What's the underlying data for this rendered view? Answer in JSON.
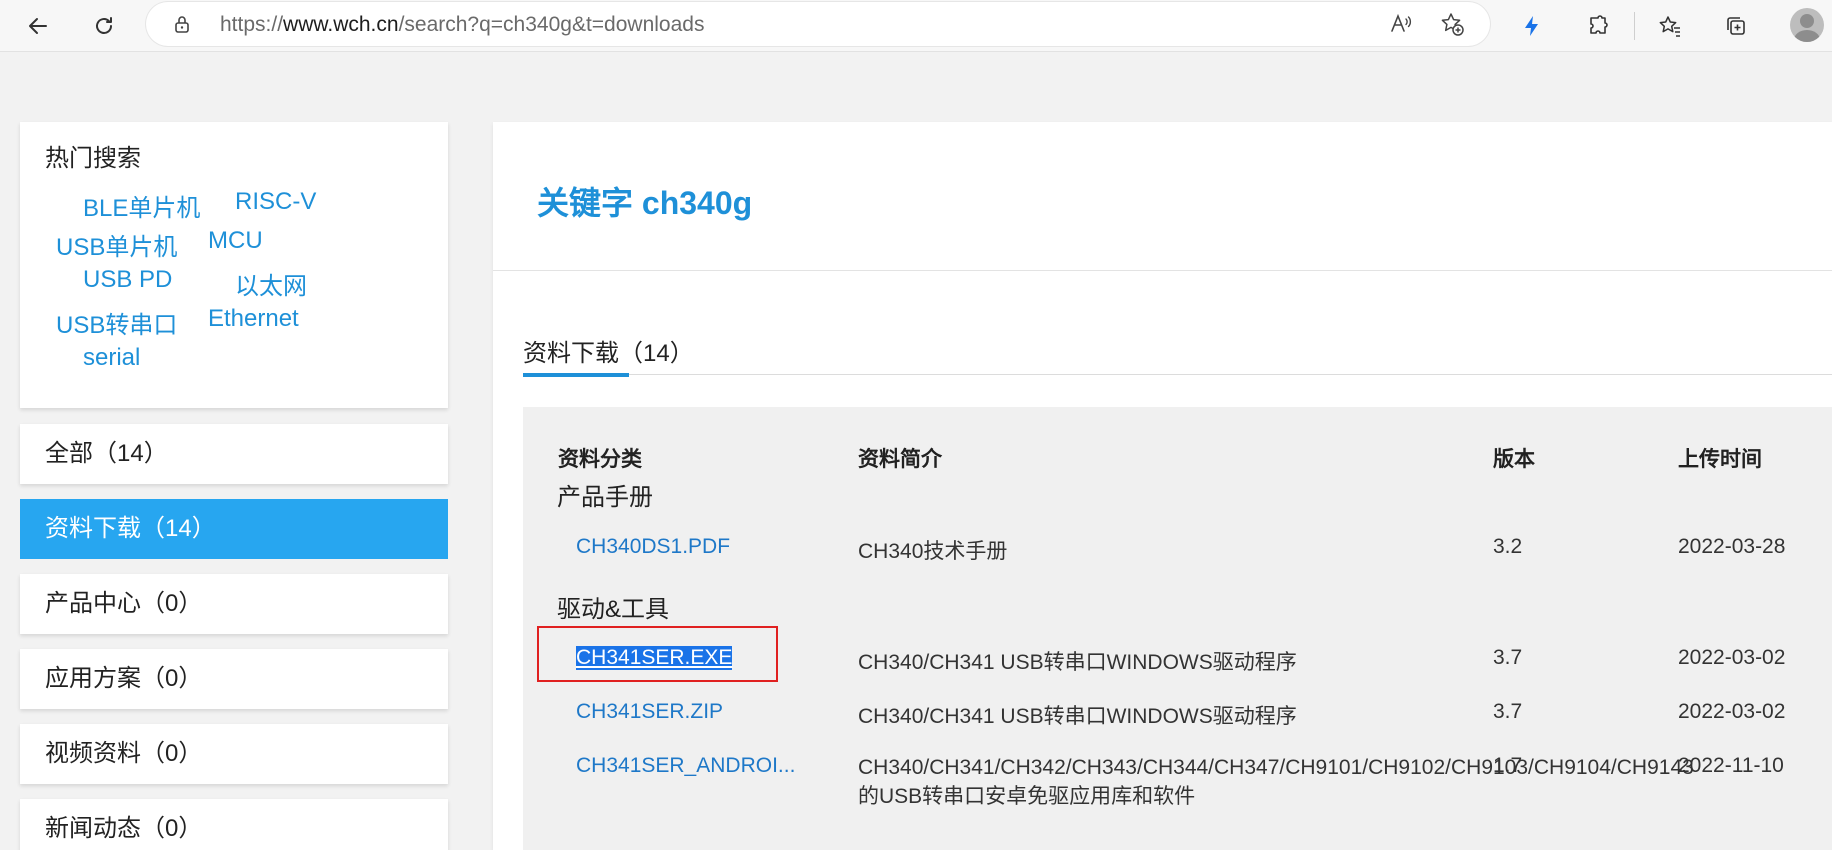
{
  "browser": {
    "url_scheme": "https://",
    "url_host": "www.wch.cn",
    "url_path": "/search?q=ch340g&t=downloads"
  },
  "hot_search": {
    "title": "热门搜索",
    "keywords": [
      "BLE单片机",
      "RISC-V",
      "USB单片机",
      "MCU",
      "USB PD",
      "以太网",
      "USB转串口",
      "Ethernet",
      "serial"
    ]
  },
  "categories": [
    {
      "label": "全部（14）"
    },
    {
      "label": "资料下载（14）"
    },
    {
      "label": "产品中心（0）"
    },
    {
      "label": "应用方案（0）"
    },
    {
      "label": "视频资料（0）"
    },
    {
      "label": "新闻动态（0）"
    }
  ],
  "main": {
    "keyword_title": "关键字 ch340g",
    "tab_label": "资料下载（14）",
    "columns": [
      "资料分类",
      "资料简介",
      "版本",
      "上传时间"
    ],
    "sections": [
      {
        "name": "产品手册"
      },
      {
        "name": "驱动&工具"
      }
    ],
    "rows": [
      {
        "file": "CH340DS1.PDF",
        "desc": "CH340技术手册",
        "version": "3.2",
        "date": "2022-03-28"
      },
      {
        "file": "CH341SER.EXE",
        "desc": "CH340/CH341 USB转串口WINDOWS驱动程序",
        "version": "3.7",
        "date": "2022-03-02"
      },
      {
        "file": "CH341SER.ZIP",
        "desc": "CH340/CH341 USB转串口WINDOWS驱动程序",
        "version": "3.7",
        "date": "2022-03-02"
      },
      {
        "file": "CH341SER_ANDROI...",
        "desc": "CH340/CH341/CH342/CH343/CH344/CH347/CH9101/CH9102/CH9103/CH9104/CH9143的USB转串口安卓免驱应用库和软件",
        "version": "1.7",
        "date": "2022-11-10"
      }
    ]
  },
  "colors": {
    "accent": "#27a6f0",
    "link": "#1e78c8",
    "keyword": "#1e90d8",
    "highlight_box": "#e02020"
  }
}
